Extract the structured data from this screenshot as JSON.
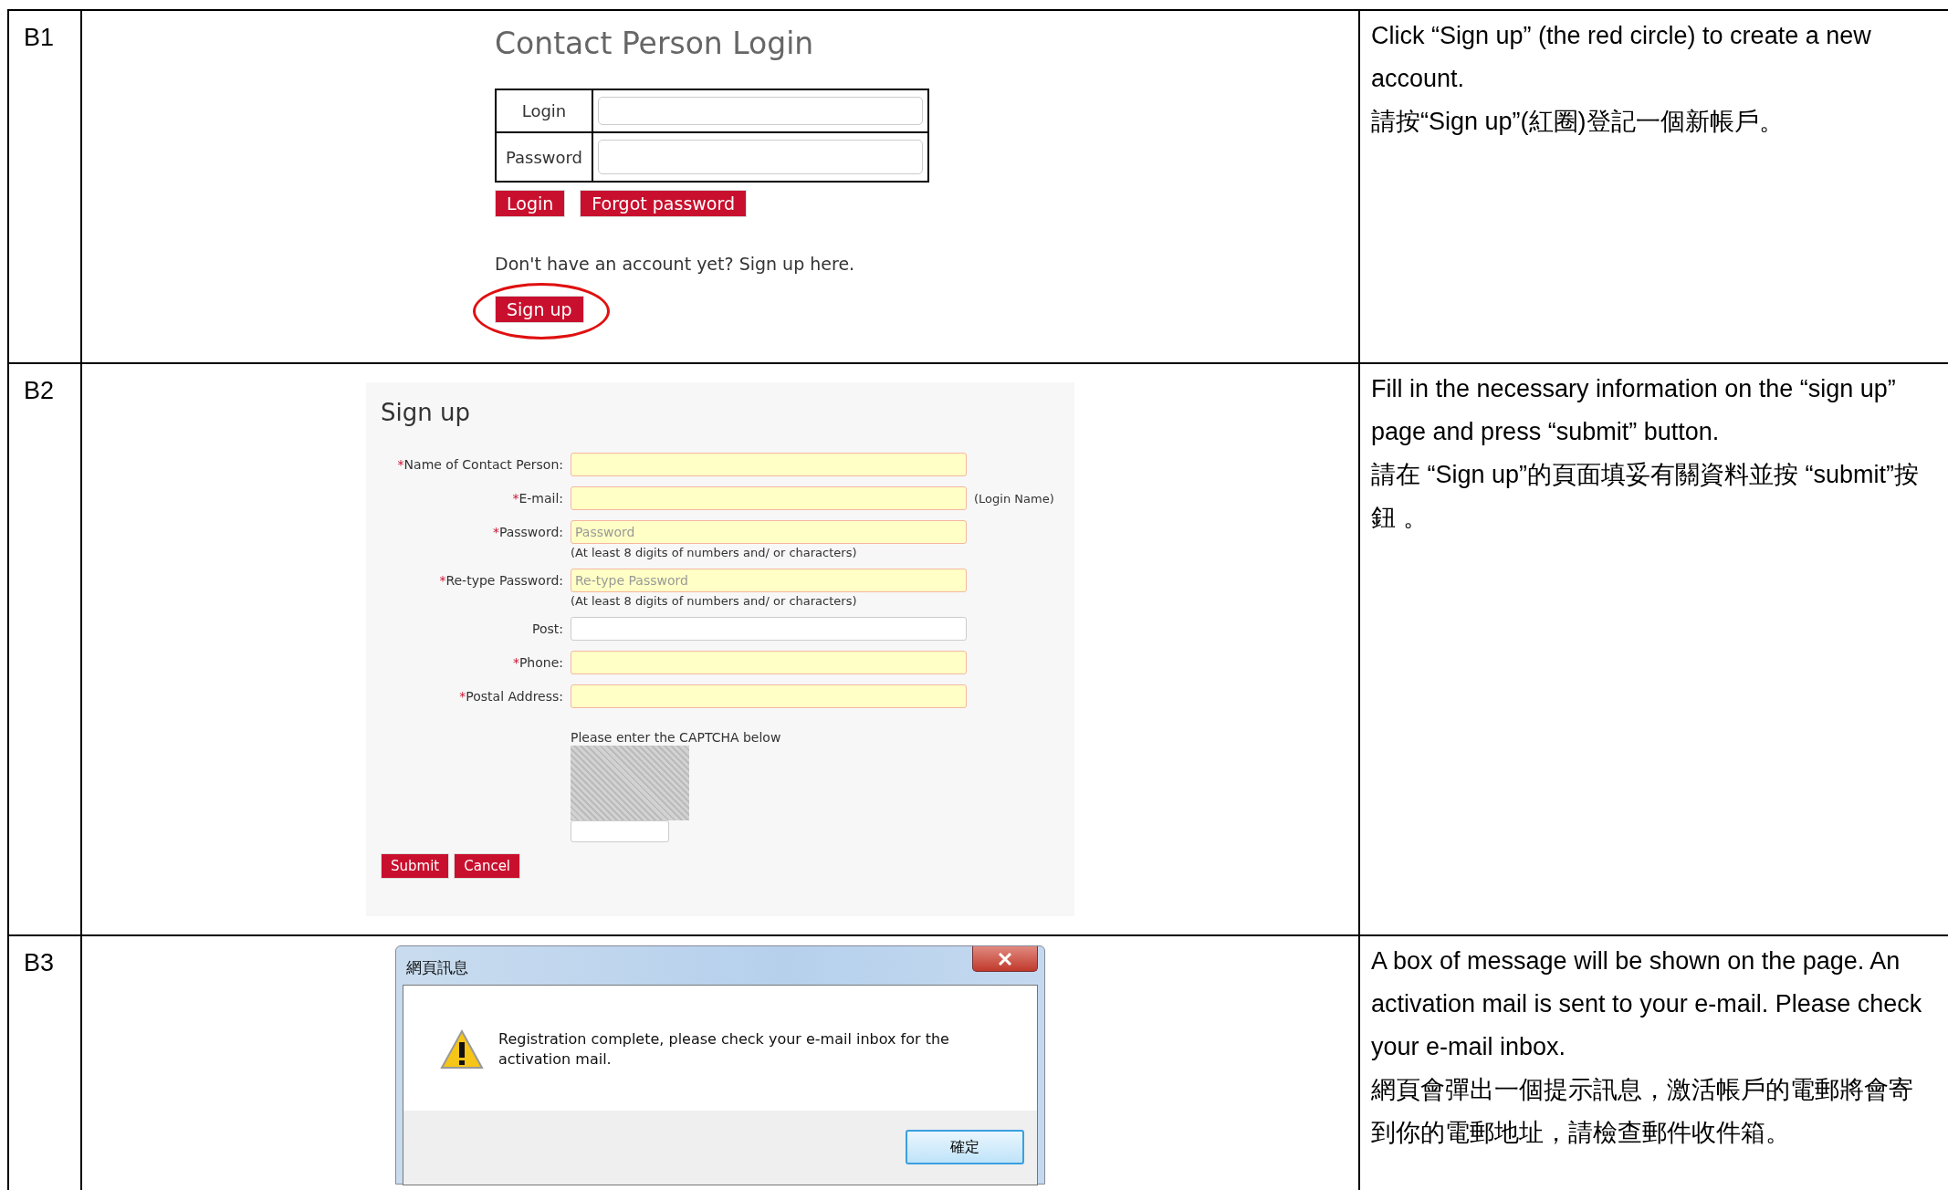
{
  "rows": [
    {
      "step": "B1",
      "screen": {
        "kind": "login",
        "title": "Contact Person Login",
        "fields": [
          {
            "label": "Login"
          },
          {
            "label": "Password"
          }
        ],
        "buttons": [
          "Login",
          "Forgot password"
        ],
        "prompt": "Don't have an account yet? Sign up here.",
        "signup": {
          "label": "Sign up",
          "circled": true
        }
      },
      "notes": [
        "Click “Sign up” (the red circle) to create a new account.",
        "請按“Sign up”(紅圈)登記一個新帳戶。"
      ]
    },
    {
      "step": "B2",
      "screen": {
        "kind": "signup",
        "title": "Sign up",
        "fields": [
          {
            "marker": "*",
            "label": "Name of Contact Person:",
            "required": true
          },
          {
            "marker": "*",
            "label": "E-mail:",
            "required": true,
            "note": "(Login Name)"
          },
          {
            "marker": "*",
            "label": "Password:",
            "required": true,
            "placeholder": "Password",
            "hint": "(At least 8 digits of numbers and/ or characters)"
          },
          {
            "marker": "*",
            "label": "Re-type Password:",
            "required": true,
            "placeholder": "Re-type Password",
            "hint": "(At least 8 digits of numbers and/ or characters)"
          },
          {
            "label": "Post:",
            "required": false
          },
          {
            "marker": "*",
            "label": "Phone:",
            "required": true
          },
          {
            "marker": "*",
            "label": "Postal Address:",
            "required": true
          }
        ],
        "captcha_prompt": "Please enter the CAPTCHA below",
        "buttons": [
          "Submit",
          "Cancel"
        ]
      },
      "notes": [
        "Fill in the necessary information on the “sign up” page and press “submit” button.",
        "請在 “Sign up”的頁面填妥有關資料並按 “submit”按鈕 。"
      ]
    },
    {
      "step": "B3",
      "screen": {
        "kind": "dialog",
        "title": "網頁訊息",
        "message": "Registration complete, please check your e-mail inbox for the activation mail.",
        "button": "確定"
      },
      "notes": [
        "A box of message will be shown on the page. An activation mail is sent to your e-mail. Please check your e-mail inbox.",
        "網頁會彈出一個提示訊息，激活帳戶的電郵將會寄到你的電郵地址，請檢查郵件收件箱。"
      ]
    }
  ]
}
